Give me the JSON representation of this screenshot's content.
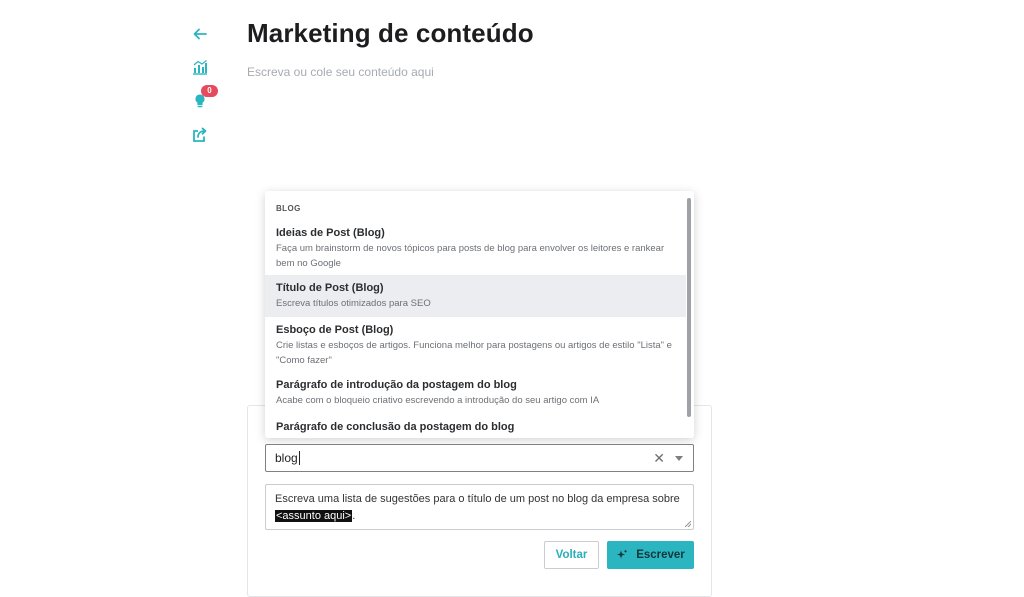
{
  "colors": {
    "accent": "#2bb5c0",
    "badge": "#e64a5d",
    "active_row": "#ebedf0"
  },
  "rail": [
    {
      "name": "back-arrow-icon"
    },
    {
      "name": "analytics-chart-icon"
    },
    {
      "name": "lightbulb-icon",
      "badge": "0"
    },
    {
      "name": "share-export-icon"
    }
  ],
  "page": {
    "title": "Marketing de conteúdo",
    "placeholder": "Escreva ou cole seu conteúdo aqui"
  },
  "menu": {
    "group_label": "BLOG",
    "items": [
      {
        "title": "Ideias de Post (Blog)",
        "description": "Faça um brainstorm de novos tópicos para posts de blog para envolver os leitores e rankear bem no Google",
        "active": false
      },
      {
        "title": "Título de Post (Blog)",
        "description": "Escreva títulos otimizados para SEO",
        "active": true
      },
      {
        "title": "Esboço de Post (Blog)",
        "description": "Crie listas e esboços de artigos. Funciona melhor para postagens ou artigos de estilo \"Lista\" e \"Como fazer\"",
        "active": false
      },
      {
        "title": "Parágrafo de introdução da postagem do blog",
        "description": "Acabe com o bloqueio criativo escrevendo a introdução do seu artigo com IA",
        "active": false
      },
      {
        "title": "Parágrafo de conclusão da postagem do blog",
        "description": "",
        "active": false
      }
    ]
  },
  "select": {
    "value": "blog",
    "clear_icon": "close-icon",
    "dropdown_icon": "chevron-down-icon"
  },
  "prompt": {
    "text": "Escreva uma lista de sugestões para o título de um post no blog da empresa sobre ",
    "highlight": "<assunto aqui>",
    "suffix": "."
  },
  "actions": {
    "back_label": "Voltar",
    "write_label": "Escrever",
    "write_icon": "sparkle-icon"
  }
}
